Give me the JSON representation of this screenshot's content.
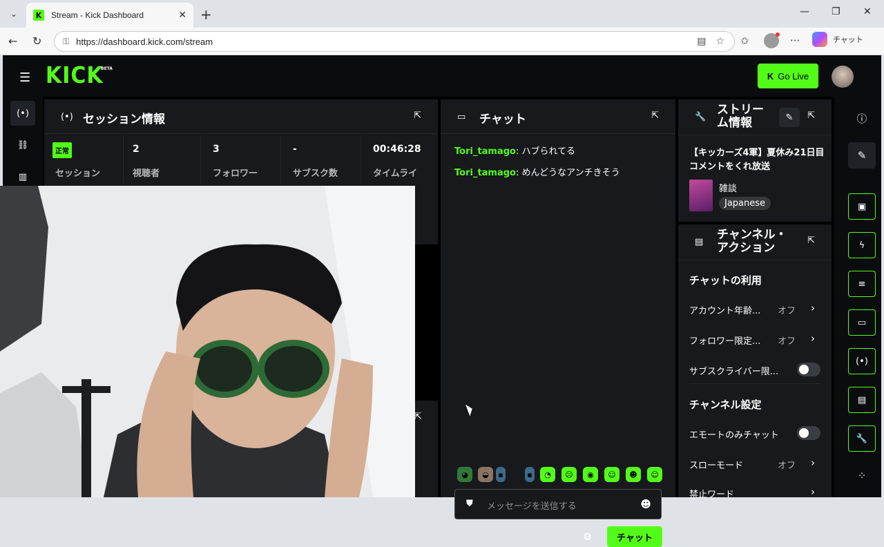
{
  "browser": {
    "tab_title": "Stream - Kick Dashboard",
    "url": "https://dashboard.kick.com/stream",
    "copilot_label": "チャット"
  },
  "app": {
    "logo": "KICK",
    "logo_badge": "BETA",
    "go_live_label": "Go Live"
  },
  "session": {
    "title": "セッション情報",
    "status_badge": "正常",
    "stats": [
      {
        "value": "",
        "label": "セッション"
      },
      {
        "value": "2",
        "label": "視聴者"
      },
      {
        "value": "3",
        "label": "フォロワー"
      },
      {
        "value": "-",
        "label": "サブスク数"
      },
      {
        "value": "00:46:28",
        "label": "タイムライ"
      }
    ]
  },
  "chat": {
    "title": "チャット",
    "messages": [
      {
        "user": "Tori_tamago",
        "text": "ハブられてる"
      },
      {
        "user": "Tori_tamago",
        "text": "めんどうなアンチきそう"
      }
    ],
    "input_placeholder": "メッセージを送信する",
    "send_label": "チャット"
  },
  "stream_info": {
    "title_line1": "ストリー",
    "title_line2": "ム情報",
    "stream_title": "【キッカーズ4軍】夏休み21日目コメントをくれ放送",
    "category": "雑談",
    "tag": "Japanese"
  },
  "channel_actions": {
    "title_line1": "チャンネル・",
    "title_line2": "アクション",
    "chat_usage_heading": "チャットの利用",
    "chat_rows": [
      {
        "label": "アカウント年齢...",
        "value": "オフ",
        "kind": "chevron"
      },
      {
        "label": "フォロワー限定...",
        "value": "オフ",
        "kind": "chevron"
      },
      {
        "label": "サブスクライバー限...",
        "value": "",
        "kind": "toggle"
      }
    ],
    "channel_settings_heading": "チャンネル設定",
    "settings_rows": [
      {
        "label": "エモートのみチャット",
        "value": "",
        "kind": "toggle"
      },
      {
        "label": "スローモード",
        "value": "オフ",
        "kind": "chevron"
      },
      {
        "label": "禁止ワード",
        "value": "",
        "kind": "chevron"
      }
    ]
  },
  "colors": {
    "brand": "#53fc18",
    "panel": "#17191c",
    "background": "#000000"
  }
}
